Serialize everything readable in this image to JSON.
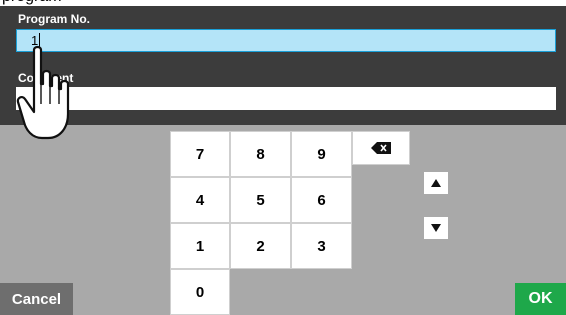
{
  "page_top_text": "program",
  "program_field": {
    "label": "Program No.",
    "value": "1"
  },
  "comment_field": {
    "label": "Comment",
    "value": ""
  },
  "keypad": {
    "keys": [
      "7",
      "8",
      "9",
      "4",
      "5",
      "6",
      "1",
      "2",
      "3",
      "0"
    ],
    "backspace_icon": "backspace-icon",
    "up_icon": "arrow-up-icon",
    "down_icon": "arrow-down-icon"
  },
  "buttons": {
    "cancel": "Cancel",
    "ok": "OK"
  },
  "colors": {
    "header": "#3c3c3c",
    "keypad_bg": "#a9a9a9",
    "input_active": "#b4e4f8",
    "input_active_border": "#1aa0d8",
    "cancel": "#6e6e6e",
    "ok": "#1ea84a"
  }
}
